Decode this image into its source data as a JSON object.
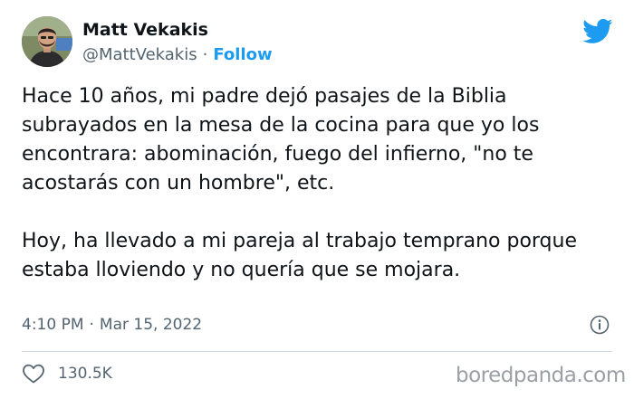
{
  "author": {
    "display_name": "Matt Vekakis",
    "handle": "@MattVekakis",
    "separator": "·",
    "follow_label": "Follow"
  },
  "tweet": {
    "paragraphs": [
      "Hace 10 años, mi padre dejó pasajes de la Biblia subrayados en la mesa de la cocina para que yo los encontrara: abominación, fuego del infierno, \"no te acostarás con un hombre\", etc.",
      "Hoy, ha llevado a mi pareja al trabajo temprano porque estaba lloviendo y no quería que se mojara."
    ],
    "time": "4:10 PM",
    "separator": "·",
    "date": "Mar 15, 2022"
  },
  "engagement": {
    "like_count": "130.5K"
  },
  "watermark": {
    "text": "boredpanda.com"
  },
  "icons": {
    "brand": "twitter-bird-icon",
    "info": "info-icon",
    "like": "heart-icon"
  },
  "colors": {
    "accent": "#1d9bf0",
    "text": "#0f1419",
    "muted": "#536471",
    "divider": "#cfd9de",
    "watermark": "#9aa0a6"
  }
}
